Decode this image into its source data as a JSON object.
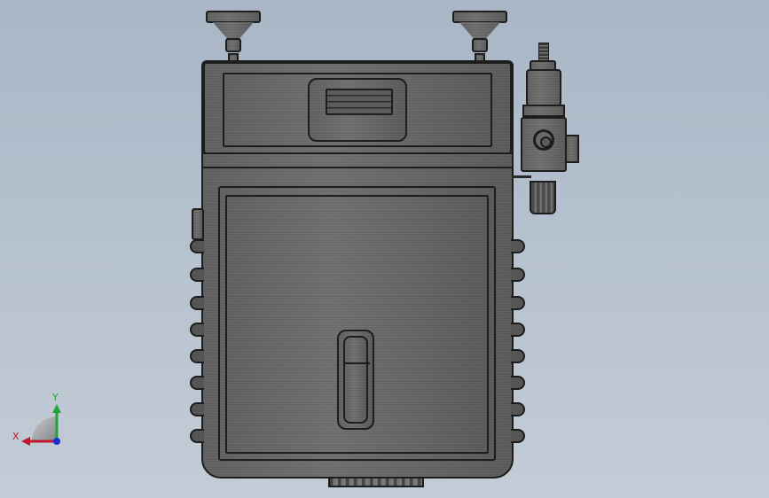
{
  "viewport": {
    "background_top": "#a9b6c6",
    "background_bottom": "#c3ccd6"
  },
  "model": {
    "body_color": "#666666",
    "outline_color": "#1d1d1d"
  },
  "triad": {
    "x_label": "X",
    "y_label": "Y",
    "x_color": "#c0182a",
    "y_color": "#1fa33a",
    "z_color": "#1e2fd0"
  }
}
